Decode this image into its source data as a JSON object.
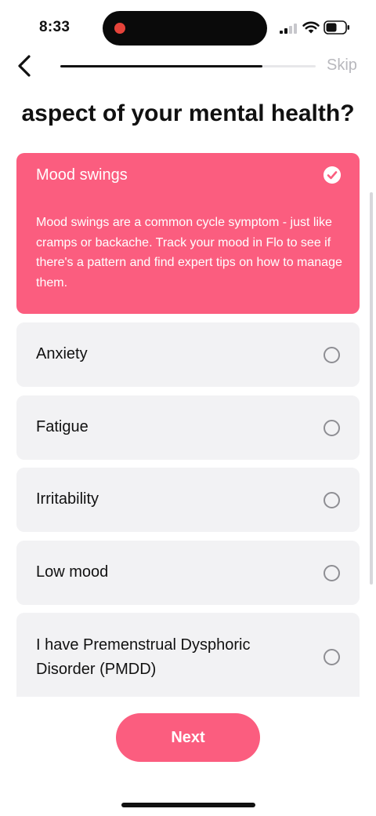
{
  "status_bar": {
    "time": "8:33"
  },
  "nav": {
    "skip_label": "Skip",
    "progress_fraction": 0.79
  },
  "question": {
    "text": "aspect of your mental health?"
  },
  "options": [
    {
      "label": "Mood swings",
      "selected": true,
      "description": "Mood swings are a common cycle symptom - just like cramps or backache. Track your mood in Flo to see if there's a pattern and find expert tips on how to manage them."
    },
    {
      "label": "Anxiety",
      "selected": false
    },
    {
      "label": "Fatigue",
      "selected": false
    },
    {
      "label": "Irritability",
      "selected": false
    },
    {
      "label": "Low mood",
      "selected": false
    },
    {
      "label": "I have Premenstrual Dysphoric Disorder (PMDD)",
      "selected": false
    }
  ],
  "next_label": "Next",
  "colors": {
    "accent": "#fb5d7f",
    "card": "#f2f2f4",
    "radio": "#8e8e93"
  }
}
